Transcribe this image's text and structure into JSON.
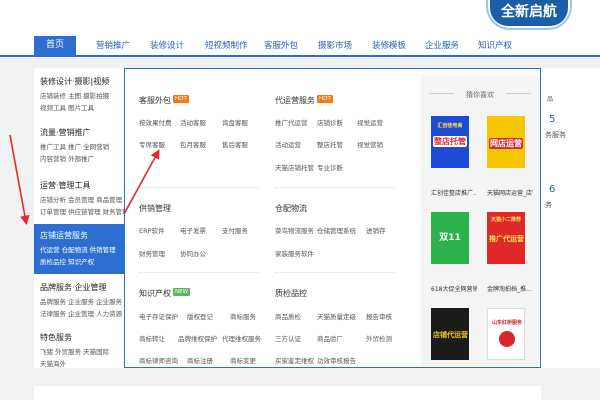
{
  "logo": {
    "text": "全新启航"
  },
  "nav": {
    "home": "首页",
    "items": [
      "营销推广",
      "装修设计",
      "短视频制作",
      "客服外包",
      "摄影市场",
      "装修模板",
      "企业服务",
      "知识产权"
    ]
  },
  "left_menu": [
    {
      "title": "装修设计·摄影|视频",
      "lines": [
        "店铺装修 主图  摄影拍摄",
        "视频工具 图片工具"
      ]
    },
    {
      "title": "流量·营销推广",
      "lines": [
        "推广工具 推广  全网营销",
        "内容营销 外部推广"
      ]
    },
    {
      "title": "运营·管理工具",
      "lines": [
        "店铺分析 会员管理 商品管理",
        "订单管理 供应链管理 财务管理"
      ]
    },
    {
      "title": "店铺运营服务",
      "lines": [
        "代运营 仓配物流 供销管理",
        "质检品控 知识产权"
      ]
    },
    {
      "title": "品牌服务·企业管理",
      "lines": [
        "品牌服务 企业服务 企业服务",
        "法律服务 企业管理 人力资源"
      ]
    },
    {
      "title": "特色服务",
      "lines": [
        "飞猪  外贸服务  天猫国际",
        "天猫海外"
      ]
    }
  ],
  "panel": {
    "sections": [
      {
        "title": "客服外包",
        "badge": "HOT",
        "links": [
          [
            "按效果付费",
            "活动客服",
            "询盘客服"
          ],
          [
            "专席客服",
            "包月客服",
            "售后客服"
          ]
        ]
      },
      {
        "title": "代运营服务",
        "badge": "HOT",
        "links": [
          [
            "推广代运营",
            "店铺诊断",
            "视觉运营"
          ],
          [
            "活动运营",
            "整店托管",
            "视觉营销"
          ],
          [
            "天猫店铺托管",
            "专业诊断"
          ]
        ]
      },
      {
        "title": "供销管理",
        "badge": "",
        "links": [
          [
            "ERP软件",
            "电子发票",
            "支付服务"
          ],
          [
            "财务管理",
            "协同办公"
          ]
        ]
      },
      {
        "title": "仓配物流",
        "badge": "",
        "links": [
          [
            "菜鸟物流服务",
            "仓储管理系统",
            "进销存"
          ],
          [
            "家装服务软件"
          ]
        ]
      },
      {
        "title": "知识产权",
        "badge": "NEW",
        "links": [
          [
            "电子存证保护",
            "版权登记",
            "商标服务"
          ],
          [
            "商标转让",
            "品牌维权保护",
            "代理维权服务"
          ],
          [
            "商标律师咨询",
            "商标注册",
            "商标变更"
          ]
        ]
      },
      {
        "title": "质检品控",
        "badge": "",
        "links": [
          [
            "商品质检",
            "天猫质量定级",
            "报告审核"
          ],
          [
            "三方认证",
            "商品验厂",
            "外贸检测"
          ],
          [
            "买家鉴定维权",
            "功效审核报告"
          ]
        ]
      }
    ]
  },
  "recommend": {
    "title": "猜你喜欢",
    "items": [
      {
        "caption": "汇创佳整店推广...",
        "badge_text": "汇创佳电商",
        "main_text": "整店托管"
      },
      {
        "caption": "天猫网店运营_店铺...",
        "badge_text": "",
        "main_text": "网店运营"
      },
      {
        "caption": "618大促全网营销...",
        "badge_text": "",
        "main_text": "双11"
      },
      {
        "caption": "金牌淘拍档_推...",
        "badge_text": "天猫小二推荐",
        "main_text": "推广代运营"
      },
      {
        "caption": "整店运营_代运营...",
        "badge_text": "",
        "main_text": "店铺代运营"
      },
      {
        "caption": "618大促全店营销...",
        "badge_text": "",
        "main_text": "山东红桥服务"
      }
    ]
  },
  "far_right": {
    "text1": "品",
    "text2": "5",
    "text3": "务服务",
    "text4": "6",
    "text5": "务"
  },
  "colors": {
    "accent": "#2d6fd0",
    "hot": "#f07a1a",
    "new": "#5cb85c",
    "arrow": "#e22b2b"
  }
}
